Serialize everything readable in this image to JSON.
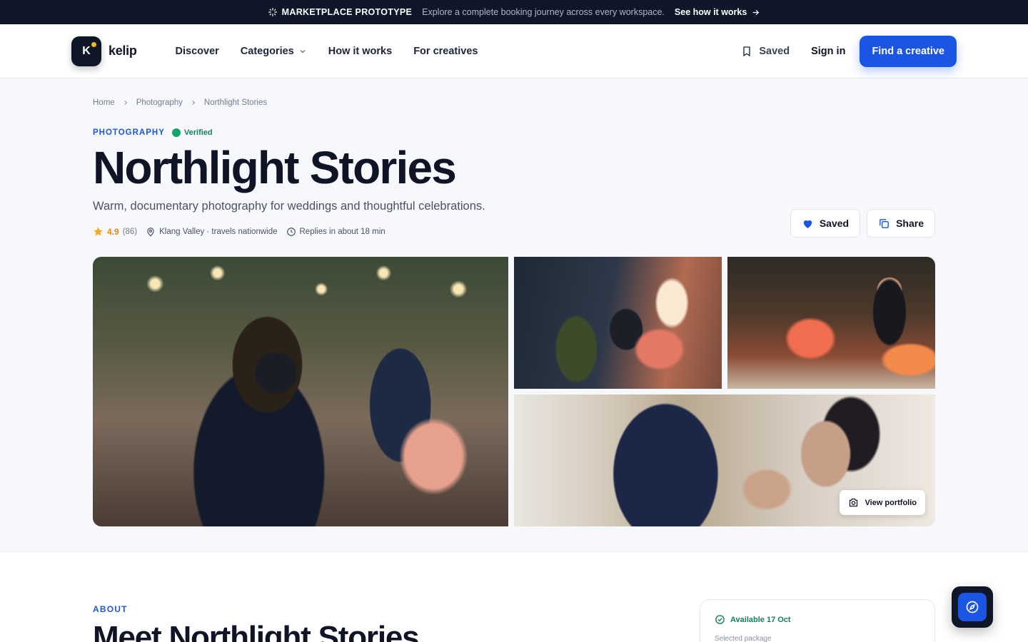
{
  "announcement": {
    "tag": "MARKETPLACE PROTOTYPE",
    "message": "Explore a complete booking journey across every workspace.",
    "link": "See how it works"
  },
  "header": {
    "logo_letter": "K",
    "brand": "kelip",
    "nav": [
      "Discover",
      "Categories",
      "How it works",
      "For creatives"
    ],
    "saved": "Saved",
    "sign_in": "Sign in",
    "cta": "Find a creative"
  },
  "breadcrumb": [
    "Home",
    "Photography",
    "Northlight Stories"
  ],
  "listing": {
    "category": "PHOTOGRAPHY",
    "verified": "Verified",
    "title": "Northlight Stories",
    "subtitle": "Warm, documentary photography for weddings and thoughtful celebrations.",
    "rating": "4.9",
    "reviews": "(86)",
    "location": "Klang Valley · travels nationwide",
    "response": "Replies in about 18 min",
    "saved_button": "Saved",
    "share_button": "Share",
    "portfolio_button": "View portfolio"
  },
  "about": {
    "label": "ABOUT",
    "title": "Meet Northlight Stories"
  },
  "booking": {
    "availability": "Available 17 Oct",
    "package_label": "Selected package"
  },
  "colors": {
    "accent": "#1a55e3",
    "dark": "#0e1628",
    "verified": "#16a36e",
    "star": "#f5a623"
  }
}
